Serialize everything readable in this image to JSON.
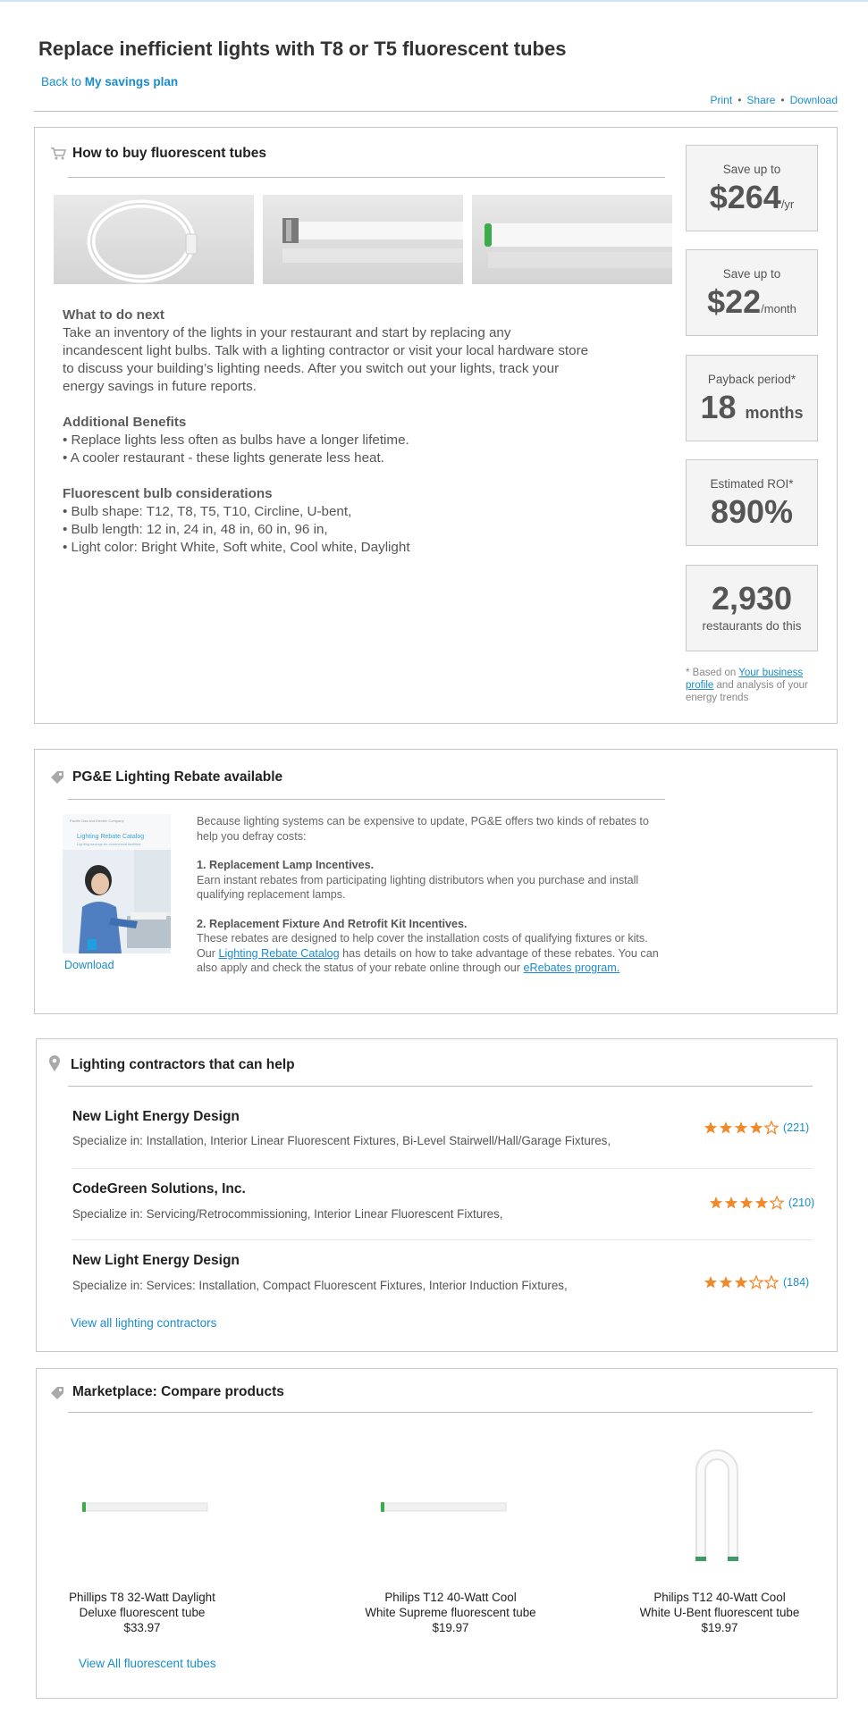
{
  "page": {
    "title": "Replace inefficient lights with T8 or T5 fluorescent tubes",
    "back_prefix": "Back to",
    "back_link": "My savings plan",
    "actions": [
      "Print",
      "Share",
      "Download"
    ]
  },
  "how_to_buy": {
    "title": "How to buy fluorescent tubes",
    "icon": "cart-icon",
    "images": [
      "circline-tube-image",
      "t12-tube-image",
      "t8-tube-image"
    ],
    "next_heading": "What to do next",
    "next_lines": [
      "Take an inventory of the lights in your restaurant and start by replacing any",
      "incandescent light bulbs. Talk with a lighting contractor or visit your local hardware store",
      "to discuss your building’s lighting needs. After you switch out your lights, track your",
      "energy savings in future reports."
    ],
    "benefits_heading": "Additional Benefits",
    "benefits": [
      "• Replace lights less often as bulbs have a longer lifetime.",
      "• A cooler restaurant - these lights generate less heat."
    ],
    "considerations_heading": "Fluorescent bulb considerations",
    "considerations": [
      "• Bulb shape: T12, T8, T5, T10, Circline, U-bent,",
      "• Bulb length: 12 in, 24 in, 48 in, 60 in, 96 in,",
      "• Light color: Bright White, Soft white, Cool white, Daylight"
    ]
  },
  "stats": {
    "yearly": {
      "label": "Save up to",
      "value": "$264",
      "unit": "/yr"
    },
    "monthly": {
      "label": "Save up to",
      "value": "$22",
      "unit": "/month"
    },
    "payback": {
      "label": "Payback period*",
      "value": "18",
      "unit": "months"
    },
    "roi": {
      "label": "Estimated ROI*",
      "value": "890%"
    },
    "count": {
      "value": "2,930",
      "label": "restaurants do this"
    },
    "footnote_prefix": "* Based on",
    "footnote_link": "Your business profile",
    "footnote_suffix": "and analysis of your energy trends"
  },
  "rebate": {
    "title": "PG&E Lighting Rebate available",
    "icon": "tag-icon",
    "catalog_title": "Lighting Rebate Catalog",
    "catalog_subtitle": "Lighting savings for commercial facilities",
    "catalog_header": "Pacific Gas and Electric Company",
    "download": "Download",
    "intro": "Because lighting systems can be expensive to update, PG&E offers two kinds of rebates to help you defray costs:",
    "item1_title": "1. Replacement Lamp Incentives.",
    "item1_text": "Earn instant rebates from participating lighting distributors when you purchase and install qualifying replacement lamps.",
    "item2_title": "2. Replacement Fixture And Retrofit Kit Incentives.",
    "item2_text_a": "These rebates are designed to help cover the installation costs of qualifying fixtures or kits. Our",
    "item2_link": "Lighting Rebate Catalog",
    "item2_text_b": "has details on how to take advantage of these rebates. You can also apply and check the status of your rebate online through our",
    "item2_link2": "eRebates program."
  },
  "contractors": {
    "title": "Lighting contractors that can help",
    "icon": "map-pin-icon",
    "items": [
      {
        "name": "New Light Energy Design",
        "spec": "Specialize in: Installation, Interior Linear Fluorescent Fixtures, Bi-Level Stairwell/Hall/Garage Fixtures,",
        "stars": 4,
        "reviews": "(221)"
      },
      {
        "name": "CodeGreen Solutions, Inc.",
        "spec": "Specialize in: Servicing/Retrocommissioning, Interior Linear Fluorescent Fixtures,",
        "stars": 4,
        "reviews": "(210)"
      },
      {
        "name": "New Light Energy Design",
        "spec": "Specialize in: Services: Installation, Compact Fluorescent Fixtures, Interior Induction Fixtures,",
        "stars": 3,
        "reviews": "(184)"
      }
    ],
    "view_all": "View all lighting contractors"
  },
  "marketplace": {
    "title": "Marketplace: Compare products",
    "icon": "tag-icon",
    "products": [
      {
        "line1": "Phillips T8 32-Watt Daylight",
        "line2": "Deluxe fluorescent tube",
        "price": "$33.97"
      },
      {
        "line1": "Philips T12 40-Watt Cool",
        "line2": "White Supreme fluorescent tube",
        "price": "$19.97"
      },
      {
        "line1": "Philips T12 40-Watt Cool",
        "line2": "White U-Bent fluorescent tube",
        "price": "$19.97"
      }
    ],
    "view_all": "View All fluorescent tubes"
  },
  "colors": {
    "link": "#1a8ccb",
    "star": "#f0892a",
    "stat_bg": "#f4f4f4",
    "border": "#c8c8c8"
  }
}
